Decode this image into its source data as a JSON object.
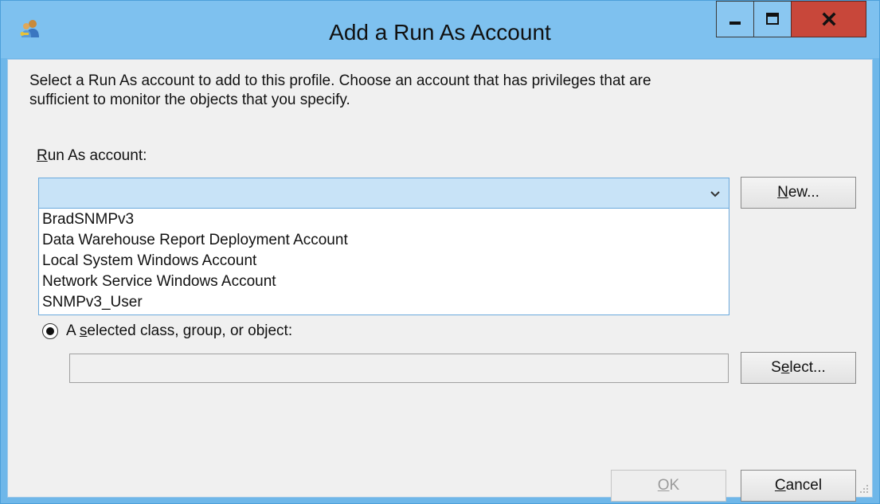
{
  "window": {
    "title": "Add a Run As Account",
    "app_icon": "users-key-icon"
  },
  "caption_buttons": {
    "minimize_icon": "minimize-icon",
    "maximize_icon": "maximize-icon",
    "close_icon": "close-icon"
  },
  "instructions": {
    "line1": "Select a Run As account to add to this profile.  Choose an account that has privileges that are",
    "line2": "sufficient to monitor the objects that you specify."
  },
  "run_as": {
    "label_mnemonic": "R",
    "label_rest": "un As account:",
    "selected_value": "",
    "chevron_icon": "chevron-down-icon",
    "options": [
      "BradSNMPv3",
      "Data Warehouse Report Deployment Account",
      "Local System Windows Account",
      "Network Service Windows Account",
      "SNMPv3_User"
    ]
  },
  "buttons": {
    "new_mnemonic": "N",
    "new_rest": "ew...",
    "select_pre": "S",
    "select_mnemonic": "e",
    "select_rest": "lect...",
    "ok_mnemonic": "O",
    "ok_rest": "K",
    "cancel_mnemonic": "C",
    "cancel_rest": "ancel"
  },
  "scope": {
    "radio_selected": true,
    "label_pre": "A ",
    "label_mnemonic": "s",
    "label_rest": "elected class, group, or object:",
    "value": ""
  },
  "colors": {
    "title_bar": "#7ec1ef",
    "close_button": "#c8473a",
    "combo_highlight": "#c8e3f7"
  }
}
